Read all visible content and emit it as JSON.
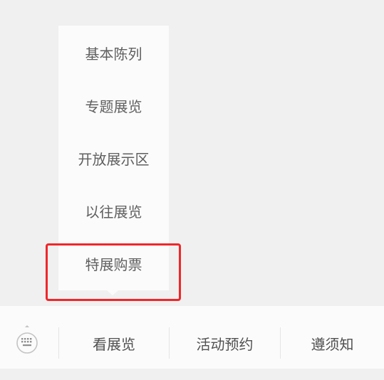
{
  "popup_menu": {
    "items": [
      {
        "label": "基本陈列"
      },
      {
        "label": "专题展览"
      },
      {
        "label": "开放展示区"
      },
      {
        "label": "以往展览"
      },
      {
        "label": "特展购票"
      }
    ]
  },
  "bottom_bar": {
    "keyboard_icon": "keyboard-icon",
    "tabs": [
      {
        "label": "看展览"
      },
      {
        "label": "活动预约"
      },
      {
        "label": "遵须知"
      }
    ]
  },
  "colors": {
    "highlight_border": "#f0262a",
    "menu_text": "#5f5f5f",
    "tab_text": "#505050"
  }
}
